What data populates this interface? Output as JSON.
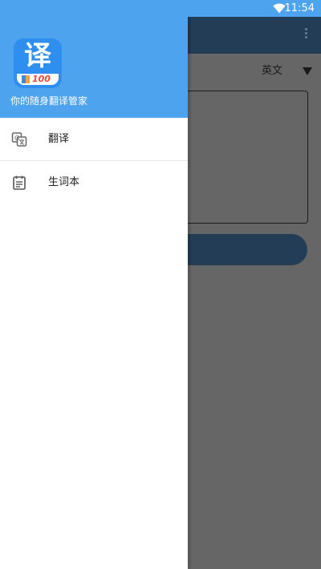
{
  "status_bar": {
    "time": "11:54",
    "icons": [
      "wifi-icon"
    ]
  },
  "drawer": {
    "logo": {
      "char": "译",
      "number": "100"
    },
    "tagline": "你的随身翻译管家",
    "items": [
      {
        "label": "翻译",
        "icon": "translate-icon"
      },
      {
        "label": "生词本",
        "icon": "notebook-icon"
      }
    ]
  },
  "background": {
    "language": "英文",
    "icons": [
      "overflow-menu-icon",
      "dropdown-arrow-icon"
    ]
  },
  "colors": {
    "primary": "#4da3ee",
    "logo": "#2f8ff0",
    "toolbar_dark": "#233d56",
    "scrim": "#666666"
  }
}
